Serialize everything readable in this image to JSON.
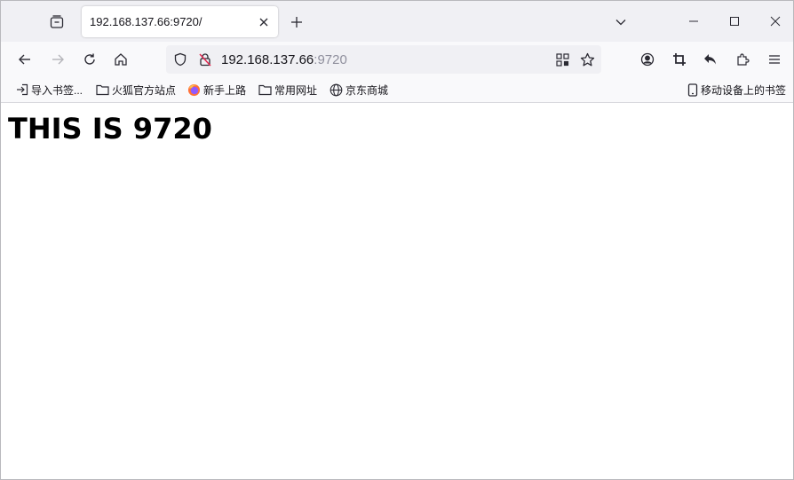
{
  "tab": {
    "title": "192.168.137.66:9720/"
  },
  "urlbar": {
    "host": "192.168.137.66",
    "port": ":9720"
  },
  "bookmarks": {
    "items": [
      {
        "label": "导入书签...",
        "icon": "import-icon"
      },
      {
        "label": "火狐官方站点",
        "icon": "folder-icon"
      },
      {
        "label": "新手上路",
        "icon": "firefox-icon"
      },
      {
        "label": "常用网址",
        "icon": "folder-icon"
      },
      {
        "label": "京东商城",
        "icon": "globe-icon"
      }
    ],
    "mobile": {
      "label": "移动设备上的书签",
      "icon": "mobile-icon"
    }
  },
  "page": {
    "heading": "THIS IS 9720"
  },
  "colors": {
    "tabstrip_bg": "#f0f0f4",
    "toolbar_bg": "#f9f9fb",
    "urlbar_bg": "#f0f0f4",
    "text": "#15141a",
    "url_port": "#8f8f9d",
    "lock_warning": "#e22850"
  }
}
